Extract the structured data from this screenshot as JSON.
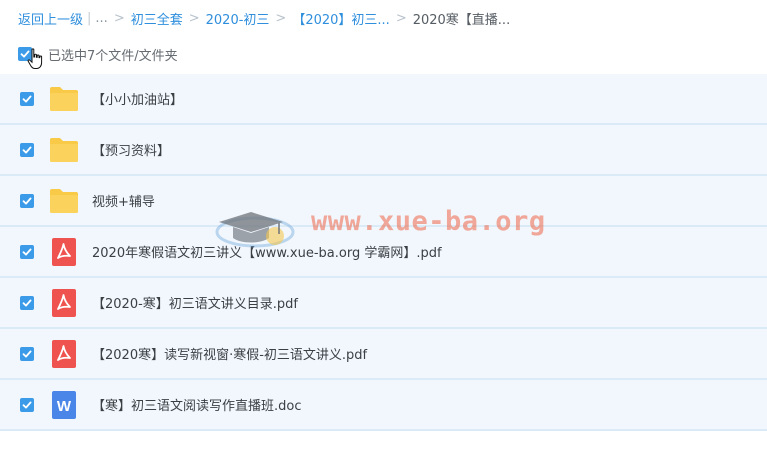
{
  "breadcrumb": {
    "back_label": "返回上一级",
    "ellipsis": "...",
    "separator": ">",
    "items": [
      "初三全套",
      "2020-初三",
      "【2020】初三..."
    ],
    "current": "2020寒【直播..."
  },
  "selection": {
    "label": "已选中7个文件/文件夹"
  },
  "files": [
    {
      "name": "【小小加油站】",
      "type": "folder-icon",
      "checked": true
    },
    {
      "name": "【预习资料】",
      "type": "folder-icon",
      "checked": true
    },
    {
      "name": "视频+辅导",
      "type": "folder-icon",
      "checked": true
    },
    {
      "name": "2020年寒假语文初三讲义【www.xue-ba.org 学霸网】.pdf",
      "type": "pdf-icon",
      "checked": true
    },
    {
      "name": "【2020-寒】初三语文讲义目录.pdf",
      "type": "pdf-icon",
      "checked": true
    },
    {
      "name": "【2020寒】读写新视窗·寒假-初三语文讲义.pdf",
      "type": "pdf-icon",
      "checked": true
    },
    {
      "name": "【寒】初三语文阅读写作直播班.doc",
      "type": "word-icon",
      "checked": true
    }
  ],
  "watermark": {
    "text": "www.xue-ba.org"
  },
  "colors": {
    "accent": "#3b9be8",
    "link": "#2f8fdd",
    "folder": "#f9c948",
    "pdf": "#ef5350",
    "word": "#4a86e8",
    "row_bg": "#f1f7fd"
  }
}
